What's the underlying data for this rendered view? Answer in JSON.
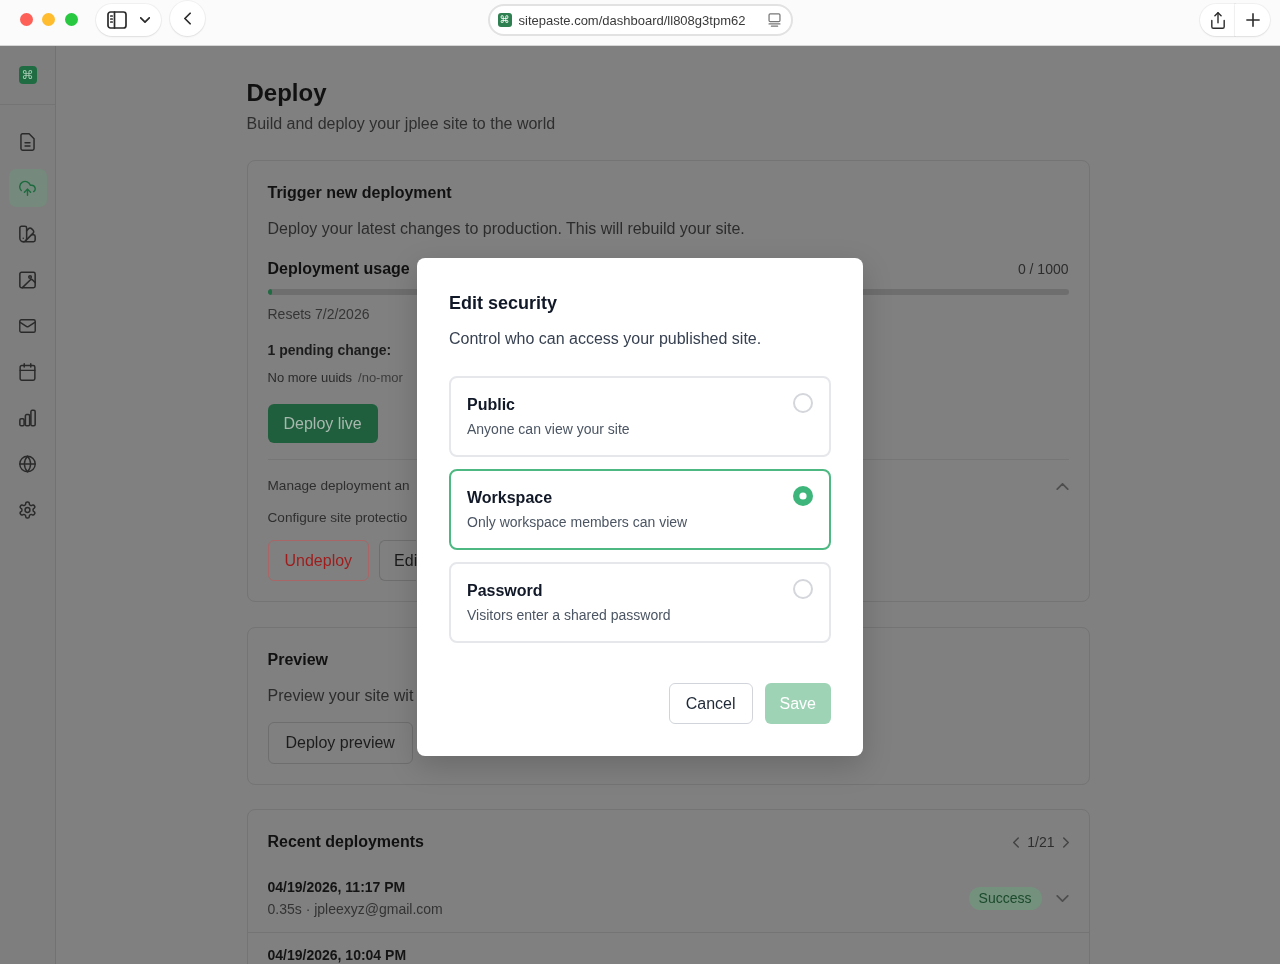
{
  "browser": {
    "favicon": "⌘",
    "url": "sitepaste.com/dashboard/ll808g3tpm62"
  },
  "sidebar": {
    "logo": "⌘",
    "items": [
      {
        "selected": false
      },
      {
        "selected": true
      },
      {
        "selected": false
      },
      {
        "selected": false
      },
      {
        "selected": false
      },
      {
        "selected": false
      },
      {
        "selected": false
      },
      {
        "selected": false
      },
      {
        "selected": false
      }
    ]
  },
  "page": {
    "title": "Deploy",
    "subtitle": "Build and deploy your jplee site to the world"
  },
  "trigger_card": {
    "title": "Trigger new deployment",
    "description": "Deploy your latest changes to production. This will rebuild your site.",
    "usage": {
      "label": "Deployment usage",
      "count": "0 / 1000",
      "level": 0.005,
      "resets": "Resets 7/2/2026"
    },
    "pending": {
      "heading": "1 pending change:",
      "items": [
        {
          "title": "No more uuids",
          "path": "/no-mor"
        }
      ]
    },
    "deploy_button": "Deploy live",
    "manage": {
      "label": "Manage deployment an",
      "expanded": true,
      "description": "Configure site protectio",
      "buttons": [
        {
          "label": "Undeploy",
          "kind": "danger"
        },
        {
          "label": "Edi",
          "kind": "outline"
        }
      ]
    }
  },
  "preview_card": {
    "title": "Preview",
    "description": "Preview your site wit",
    "button": "Deploy preview"
  },
  "recent_card": {
    "title": "Recent deployments",
    "pager": "1/21",
    "rows": [
      {
        "date": "04/19/2026, 11:17 PM",
        "meta": "0.35s · jpleexyz@gmail.com",
        "status": "Success",
        "expanded": false
      },
      {
        "date": "04/19/2026, 10:04 PM"
      }
    ]
  },
  "dialog": {
    "title": "Edit security",
    "description": "Control who can access your published site.",
    "options": [
      {
        "title": "Public",
        "description": "Anyone can view your site",
        "selected": false
      },
      {
        "title": "Workspace",
        "description": "Only workspace members can view",
        "selected": true
      },
      {
        "title": "Password",
        "description": "Visitors enter a shared password",
        "selected": false
      }
    ],
    "buttons": [
      {
        "label": "Cancel",
        "kind": "secondary",
        "disabled": false
      },
      {
        "label": "Save",
        "kind": "primary",
        "disabled": true
      }
    ]
  }
}
